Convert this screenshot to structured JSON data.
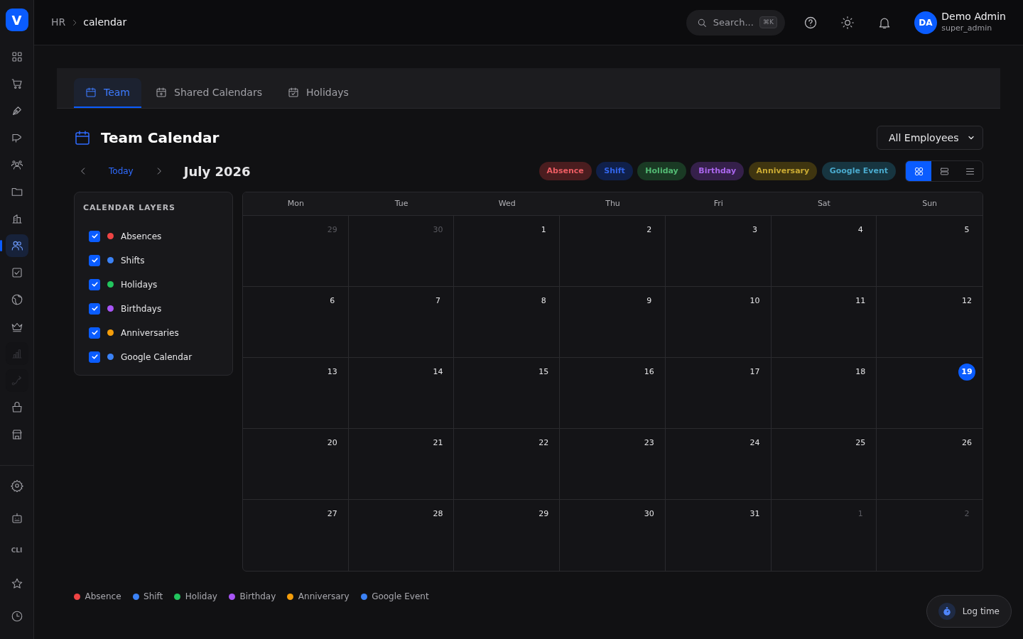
{
  "logo": {
    "letter": "V"
  },
  "sidebar": {
    "items": [
      {
        "kind": "grid",
        "selected": false,
        "disabled": false
      },
      {
        "kind": "cart",
        "selected": false,
        "disabled": false
      },
      {
        "kind": "pen",
        "selected": false,
        "disabled": false
      },
      {
        "kind": "megaphone",
        "selected": false,
        "disabled": false
      },
      {
        "kind": "group",
        "selected": false,
        "disabled": false
      },
      {
        "kind": "folder",
        "selected": false,
        "disabled": false
      },
      {
        "kind": "building",
        "selected": false,
        "disabled": false
      },
      {
        "kind": "users",
        "selected": true,
        "disabled": false
      },
      {
        "kind": "checkbox",
        "selected": false,
        "disabled": false
      },
      {
        "kind": "globe",
        "selected": false,
        "disabled": false
      },
      {
        "kind": "crown",
        "selected": false,
        "disabled": false
      },
      {
        "kind": "chart",
        "selected": false,
        "disabled": true
      },
      {
        "kind": "route",
        "selected": false,
        "disabled": true
      },
      {
        "kind": "basket",
        "selected": false,
        "disabled": false
      },
      {
        "kind": "store",
        "selected": false,
        "disabled": false
      }
    ],
    "bottom": [
      {
        "kind": "gear"
      },
      {
        "kind": "robot"
      },
      {
        "kind": "text",
        "label": "CLI"
      },
      {
        "kind": "star"
      },
      {
        "kind": "clock"
      }
    ]
  },
  "breadcrumb": [
    "HR",
    "calendar"
  ],
  "search": {
    "placeholder": "Search...",
    "shortcut": "⌘K"
  },
  "user": {
    "initials": "DA",
    "name": "Demo Admin",
    "role": "super_admin"
  },
  "tabs": [
    {
      "label": "Team",
      "kind": "calendar",
      "selected": true
    },
    {
      "label": "Shared Calendars",
      "kind": "calendar-plus",
      "selected": false
    },
    {
      "label": "Holidays",
      "kind": "calendar-check",
      "selected": false
    }
  ],
  "title": "Team Calendar",
  "filter": {
    "value": "All Employees"
  },
  "nav": {
    "today": "Today",
    "period": "July 2026"
  },
  "event_types": [
    {
      "label": "Absence",
      "color": "#4a1d1f"
    },
    {
      "label": "Shift",
      "color": "#10204a"
    },
    {
      "label": "Holiday",
      "color": "#1a3a24"
    },
    {
      "label": "Birthday",
      "color": "#35204a"
    },
    {
      "label": "Anniversary",
      "color": "#3f3510"
    },
    {
      "label": "Google Event",
      "color": "#173540"
    }
  ],
  "view_modes": [
    {
      "kind": "month",
      "selected": true
    },
    {
      "kind": "week",
      "selected": false
    },
    {
      "kind": "list",
      "selected": false
    }
  ],
  "layers": {
    "title": "CALENDAR LAYERS",
    "items": [
      {
        "label": "Absences",
        "color": "#ef4444",
        "checked": true
      },
      {
        "label": "Shifts",
        "color": "#3b82f6",
        "checked": true
      },
      {
        "label": "Holidays",
        "color": "#22c55e",
        "checked": true
      },
      {
        "label": "Birthdays",
        "color": "#a855f7",
        "checked": true
      },
      {
        "label": "Anniversaries",
        "color": "#f59e0b",
        "checked": true
      },
      {
        "label": "Google Calendar",
        "color": "#3b82f6",
        "checked": true
      }
    ]
  },
  "calendar": {
    "weekdays": [
      "Mon",
      "Tue",
      "Wed",
      "Thu",
      "Fri",
      "Sat",
      "Sun"
    ],
    "weeks": [
      [
        {
          "day": "29",
          "outside": true,
          "today": false
        },
        {
          "day": "30",
          "outside": true,
          "today": false
        },
        {
          "day": "1",
          "outside": false,
          "today": false
        },
        {
          "day": "2",
          "outside": false,
          "today": false
        },
        {
          "day": "3",
          "outside": false,
          "today": false
        },
        {
          "day": "4",
          "outside": false,
          "today": false
        },
        {
          "day": "5",
          "outside": false,
          "today": false
        }
      ],
      [
        {
          "day": "6",
          "outside": false,
          "today": false
        },
        {
          "day": "7",
          "outside": false,
          "today": false
        },
        {
          "day": "8",
          "outside": false,
          "today": false
        },
        {
          "day": "9",
          "outside": false,
          "today": false
        },
        {
          "day": "10",
          "outside": false,
          "today": false
        },
        {
          "day": "11",
          "outside": false,
          "today": false
        },
        {
          "day": "12",
          "outside": false,
          "today": false
        }
      ],
      [
        {
          "day": "13",
          "outside": false,
          "today": false
        },
        {
          "day": "14",
          "outside": false,
          "today": false
        },
        {
          "day": "15",
          "outside": false,
          "today": false
        },
        {
          "day": "16",
          "outside": false,
          "today": false
        },
        {
          "day": "17",
          "outside": false,
          "today": false
        },
        {
          "day": "18",
          "outside": false,
          "today": false
        },
        {
          "day": "19",
          "outside": false,
          "today": true
        }
      ],
      [
        {
          "day": "20",
          "outside": false,
          "today": false
        },
        {
          "day": "21",
          "outside": false,
          "today": false
        },
        {
          "day": "22",
          "outside": false,
          "today": false
        },
        {
          "day": "23",
          "outside": false,
          "today": false
        },
        {
          "day": "24",
          "outside": false,
          "today": false
        },
        {
          "day": "25",
          "outside": false,
          "today": false
        },
        {
          "day": "26",
          "outside": false,
          "today": false
        }
      ],
      [
        {
          "day": "27",
          "outside": false,
          "today": false
        },
        {
          "day": "28",
          "outside": false,
          "today": false
        },
        {
          "day": "29",
          "outside": false,
          "today": false
        },
        {
          "day": "30",
          "outside": false,
          "today": false
        },
        {
          "day": "31",
          "outside": false,
          "today": false
        },
        {
          "day": "1",
          "outside": true,
          "today": false
        },
        {
          "day": "2",
          "outside": true,
          "today": false
        }
      ]
    ]
  },
  "legend": [
    {
      "label": "Absence",
      "color": "#ef4444"
    },
    {
      "label": "Shift",
      "color": "#3b82f6"
    },
    {
      "label": "Holiday",
      "color": "#22c55e"
    },
    {
      "label": "Birthday",
      "color": "#a855f7"
    },
    {
      "label": "Anniversary",
      "color": "#f59e0b"
    },
    {
      "label": "Google Event",
      "color": "#3b82f6"
    }
  ],
  "log_time": {
    "label": "Log time"
  }
}
